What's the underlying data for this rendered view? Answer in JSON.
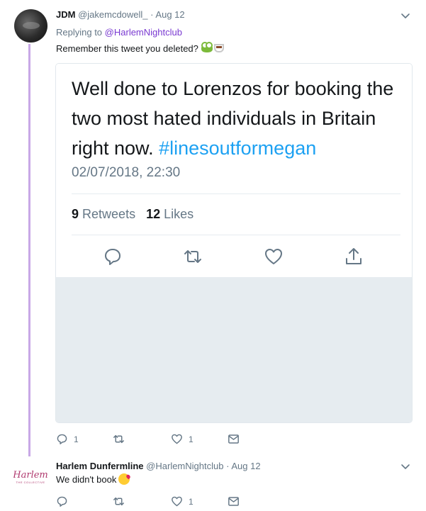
{
  "tweets": [
    {
      "name": "JDM",
      "handle": "@jakemcdowell_",
      "dot": "·",
      "date": "Aug 12",
      "replying_prefix": "Replying to",
      "replying_to": "@HarlemNightclub",
      "text": "Remember this tweet you deleted?",
      "emojis": [
        "frog-emoji",
        "tea-emoji"
      ],
      "actions": {
        "reply_count": "1",
        "retweet_count": "",
        "like_count": "1"
      }
    },
    {
      "name": "Harlem Dunfermline",
      "handle": "@HarlemNightclub",
      "dot": "·",
      "date": "Aug 12",
      "text": "We didn't book",
      "emojis": [
        "kiss-emoji"
      ],
      "avatar_logo": {
        "script": "Harlem",
        "sub": "THE COLLECTIVE"
      },
      "actions": {
        "reply_count": "",
        "retweet_count": "",
        "like_count": "1"
      }
    }
  ],
  "embedded": {
    "text_main": "Well done to Lorenzos for booking the two most hated individuals in Britain right now.",
    "hashtag": "#linesoutformegan",
    "timestamp": "02/07/2018, 22:30",
    "retweets_count": "9",
    "retweets_label": "Retweets",
    "likes_count": "12",
    "likes_label": "Likes"
  },
  "colors": {
    "thread_line": "#c8a8e6",
    "mention": "#7a3ad1",
    "hashtag": "#1da1f2",
    "muted": "#657786",
    "card_gray": "#e6ecf0"
  },
  "icons": [
    "reply-icon",
    "retweet-icon",
    "like-icon",
    "share-icon",
    "dm-icon",
    "chevron-down-icon"
  ]
}
